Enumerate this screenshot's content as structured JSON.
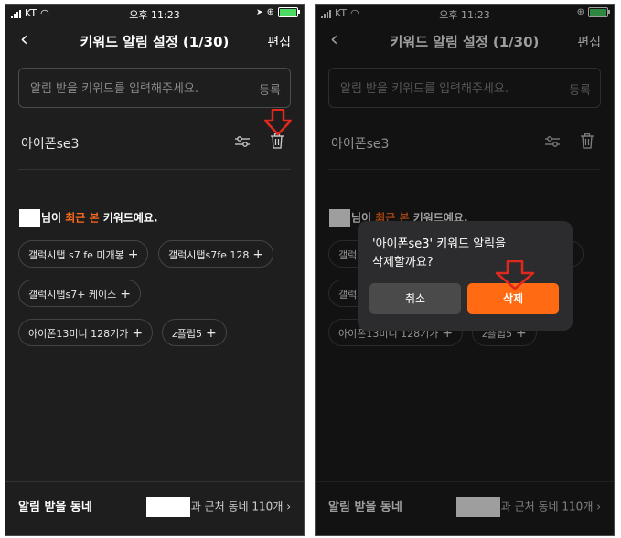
{
  "status_bar": {
    "carrier": "KT",
    "time": "오후 11:23"
  },
  "header": {
    "title": "키워드 알림 설정 (1/30)",
    "edit_label": "편집"
  },
  "search": {
    "placeholder": "알림 받을 키워드를 입력해주세요.",
    "register_label": "등록"
  },
  "keyword": {
    "text": "아이폰se3"
  },
  "recent": {
    "prefix": "님이 ",
    "highlight": "최근 본",
    "suffix": " 키워드예요."
  },
  "chips": [
    {
      "label": "갤럭시탭 s7 fe 미개봉"
    },
    {
      "label": "갤럭시탭s7fe 128"
    },
    {
      "label": "갤럭시탭s7+ 케이스"
    },
    {
      "label": "아이폰13미니 128기가"
    },
    {
      "label": "z플립5"
    }
  ],
  "bottom": {
    "label": "알림 받을 동네",
    "value": "과 근처 동네 110개",
    "chevron": "›"
  },
  "dialog": {
    "line1": "'아이폰se3' 키워드 알림을",
    "line2": "삭제할까요?",
    "cancel_label": "취소",
    "delete_label": "삭제"
  },
  "colors": {
    "accent": "#ff6b1a",
    "background": "#1e1e1e",
    "annotation_arrow": "#e0281c"
  },
  "icons": {
    "back": "chevron-left-icon",
    "filter": "sliders-icon",
    "delete": "trash-icon",
    "plus": "plus-icon"
  }
}
